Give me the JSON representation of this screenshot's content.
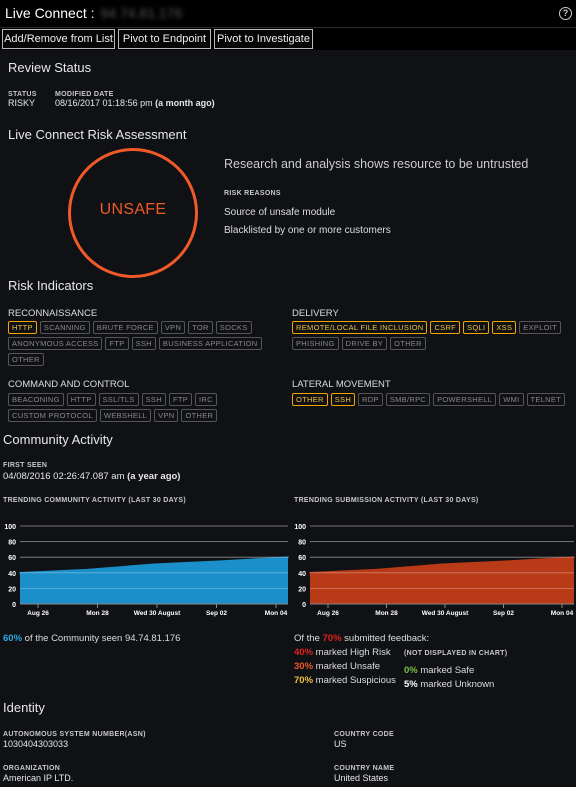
{
  "window": {
    "title": "Live Connect :",
    "ip_redacted": "94.74.81.176",
    "help": "?"
  },
  "toolbar": {
    "add_remove": "Add/Remove from List",
    "pivot_endpoint": "Pivot to Endpoint",
    "pivot_investigate": "Pivot to Investigate"
  },
  "review": {
    "heading": "Review Status",
    "status_label": "STATUS",
    "status_value": "RISKY",
    "modified_label": "MODIFIED DATE",
    "modified_value": "08/16/2017 01:18:56 pm",
    "modified_rel": "(a month ago)"
  },
  "assessment": {
    "heading": "Live Connect Risk Assessment",
    "verdict": "UNSAFE",
    "summary": "Research and analysis shows resource to be untrusted",
    "reasons_label": "RISK REASONS",
    "reasons": [
      "Source of unsafe module",
      "Blacklisted by one or more customers"
    ]
  },
  "indicators": {
    "heading": "Risk Indicators",
    "groups": [
      {
        "name": "RECONNAISSANCE",
        "tags": [
          {
            "t": "HTTP",
            "on": true
          },
          {
            "t": "SCANNING",
            "on": false
          },
          {
            "t": "BRUTE FORCE",
            "on": false
          },
          {
            "t": "VPN",
            "on": false
          },
          {
            "t": "TOR",
            "on": false
          },
          {
            "t": "SOCKS",
            "on": false
          },
          {
            "t": "ANONYMOUS ACCESS",
            "on": false
          },
          {
            "t": "FTP",
            "on": false
          },
          {
            "t": "SSH",
            "on": false
          },
          {
            "t": "BUSINESS APPLICATION",
            "on": false
          },
          {
            "t": "OTHER",
            "on": false
          }
        ]
      },
      {
        "name": "DELIVERY",
        "tags": [
          {
            "t": "REMOTE/LOCAL FILE INCLUSION",
            "on": true
          },
          {
            "t": "CSRF",
            "on": true
          },
          {
            "t": "SQLI",
            "on": true
          },
          {
            "t": "XSS",
            "on": true
          },
          {
            "t": "EXPLOIT",
            "on": false
          },
          {
            "t": "PHISHING",
            "on": false
          },
          {
            "t": "DRIVE BY",
            "on": false
          },
          {
            "t": "OTHER",
            "on": false
          }
        ]
      },
      {
        "name": "COMMAND AND CONTROL",
        "tags": [
          {
            "t": "BEACONING",
            "on": false
          },
          {
            "t": "HTTP",
            "on": false
          },
          {
            "t": "SSL/TLS",
            "on": false
          },
          {
            "t": "SSH",
            "on": false
          },
          {
            "t": "FTP",
            "on": false
          },
          {
            "t": "IRC",
            "on": false
          },
          {
            "t": "CUSTOM PROTOCOL",
            "on": false
          },
          {
            "t": "WEBSHELL",
            "on": false
          },
          {
            "t": "VPN",
            "on": false
          },
          {
            "t": "OTHER",
            "on": false
          }
        ]
      },
      {
        "name": "LATERAL MOVEMENT",
        "tags": [
          {
            "t": "OTHER",
            "on": true
          },
          {
            "t": "SSH",
            "on": true
          },
          {
            "t": "RDP",
            "on": false
          },
          {
            "t": "SMB/RPC",
            "on": false
          },
          {
            "t": "POWERSHELL",
            "on": false
          },
          {
            "t": "WMI",
            "on": false
          },
          {
            "t": "TELNET",
            "on": false
          }
        ]
      }
    ]
  },
  "community": {
    "heading": "Community Activity",
    "first_seen_label": "FIRST SEEN",
    "first_seen_value": "04/08/2016 02:26:47.087 am",
    "first_seen_rel": "(a year ago)",
    "seen_pct": "60%",
    "seen_text": "of the Community seen 94.74.81.176",
    "fb_prefix": "Of the",
    "fb_pct": "70%",
    "fb_suffix": "submitted feedback:",
    "not_displayed": "(NOT DISPLAYED IN CHART)",
    "high_risk_pct": "40%",
    "high_risk_text": "marked High Risk",
    "unsafe_pct": "30%",
    "unsafe_text": "marked Unsafe",
    "suspicious_pct": "70%",
    "suspicious_text": "marked Suspicious",
    "safe_pct": "0%",
    "safe_text": "marked Safe",
    "unknown_pct": "5%",
    "unknown_text": "marked Unknown"
  },
  "chart_data": [
    {
      "type": "area",
      "title": "TRENDING COMMUNITY ACTIVITY (LAST 30 DAYS)",
      "color": "#1b8fc9",
      "x": [
        "Aug 26",
        "Mon 28",
        "Wed 30 August",
        "Sep 02",
        "Mon 04"
      ],
      "values": [
        40,
        44,
        51,
        55,
        60
      ],
      "ylim": [
        0,
        100
      ],
      "yticks": [
        0,
        20,
        40,
        60,
        80,
        100
      ],
      "grid": true
    },
    {
      "type": "area",
      "title": "TRENDING SUBMISSION ACTIVITY (LAST 30 DAYS)",
      "color": "#b93a17",
      "x": [
        "Aug 26",
        "Mon 28",
        "Wed 30 August",
        "Sep 02",
        "Mon 04"
      ],
      "values": [
        40,
        44,
        51,
        55,
        60
      ],
      "ylim": [
        0,
        100
      ],
      "yticks": [
        0,
        20,
        40,
        60,
        80,
        100
      ],
      "grid": true
    }
  ],
  "identity": {
    "heading": "Identity",
    "asn_label": "AUTONOMOUS SYSTEM NUMBER(ASN)",
    "asn_value": "1030404303033",
    "cc_label": "COUNTRY CODE",
    "cc_value": "US",
    "org_label": "ORGANIZATION",
    "org_value": "American IP LTD.",
    "cn_label": "COUNTRY NAME",
    "cn_value": "United States"
  }
}
